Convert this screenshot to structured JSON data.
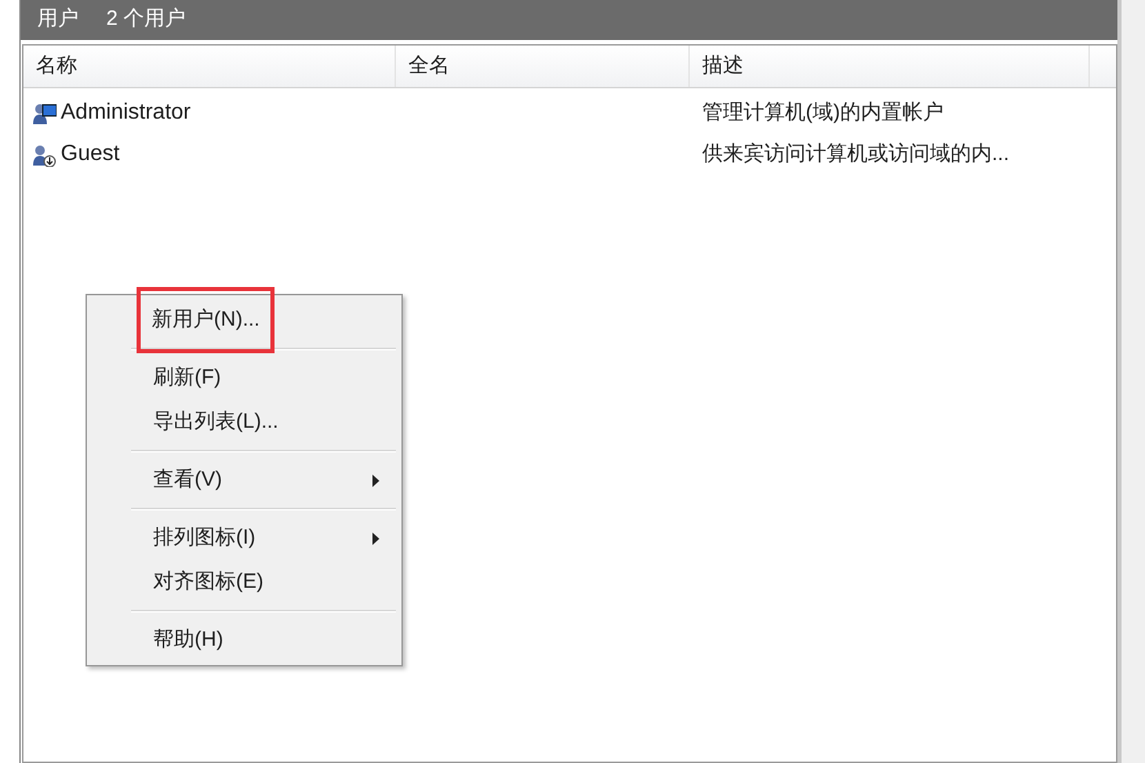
{
  "header": {
    "title": "用户",
    "count": "2 个用户"
  },
  "table": {
    "columns": [
      "名称",
      "全名",
      "描述"
    ],
    "rows": [
      {
        "name": "Administrator",
        "full_name": "",
        "description": "管理计算机(域)的内置帐户",
        "kind": "admin"
      },
      {
        "name": "Guest",
        "full_name": "",
        "description": "供来宾访问计算机或访问域的内...",
        "kind": "guest"
      }
    ]
  },
  "context_menu": {
    "items": [
      {
        "kind": "item",
        "label": "新用户(N)...",
        "submenu": false,
        "highlighted": true
      },
      {
        "kind": "separator"
      },
      {
        "kind": "item",
        "label": "刷新(F)",
        "submenu": false,
        "highlighted": false
      },
      {
        "kind": "item",
        "label": "导出列表(L)...",
        "submenu": false,
        "highlighted": false
      },
      {
        "kind": "separator"
      },
      {
        "kind": "item",
        "label": "查看(V)",
        "submenu": true,
        "highlighted": false
      },
      {
        "kind": "separator"
      },
      {
        "kind": "item",
        "label": "排列图标(I)",
        "submenu": true,
        "highlighted": false
      },
      {
        "kind": "item",
        "label": "对齐图标(E)",
        "submenu": false,
        "highlighted": false
      },
      {
        "kind": "separator"
      },
      {
        "kind": "item",
        "label": "帮助(H)",
        "submenu": false,
        "highlighted": false
      }
    ]
  }
}
